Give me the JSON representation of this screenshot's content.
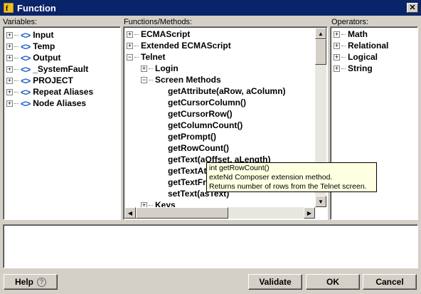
{
  "window": {
    "title": "Function",
    "close_label": "✕"
  },
  "variables": {
    "label": "Variables:",
    "items": [
      {
        "label": "Input",
        "icon": "xml-tag-icon"
      },
      {
        "label": "Temp",
        "icon": "xml-tag-icon"
      },
      {
        "label": "Output",
        "icon": "xml-tag-icon"
      },
      {
        "label": "_SystemFault",
        "icon": "xml-tag-icon"
      },
      {
        "label": "PROJECT",
        "icon": "xml-tag-icon"
      },
      {
        "label": "Repeat Aliases",
        "icon": "xml-tag-icon"
      },
      {
        "label": "Node Aliases",
        "icon": "xml-tag-icon"
      }
    ]
  },
  "functions": {
    "label": "Functions/Methods:",
    "items": [
      "ECMAScript",
      "Extended ECMAScript",
      "Telnet",
      "Login",
      "Screen Methods",
      "getAttribute(aRow, aColumn)",
      "getCursorColumn()",
      "getCursorRow()",
      "getColumnCount()",
      "getPrompt()",
      "getRowCount()",
      "getText(aOffset, aLength)",
      "getTextAt",
      "getTextFr",
      "setText(asText)",
      "Keys"
    ]
  },
  "operators": {
    "label": "Operators:",
    "items": [
      "Math",
      "Relational",
      "Logical",
      "String"
    ]
  },
  "tooltip": {
    "line1": "int getRowCount()",
    "line2": "exteNd Composer extension method.",
    "line3": "Returns number of rows from the Telnet screen."
  },
  "expression": {
    "value": ""
  },
  "buttons": {
    "help": "Help",
    "help_icon": "?",
    "validate": "Validate",
    "ok": "OK",
    "cancel": "Cancel"
  }
}
